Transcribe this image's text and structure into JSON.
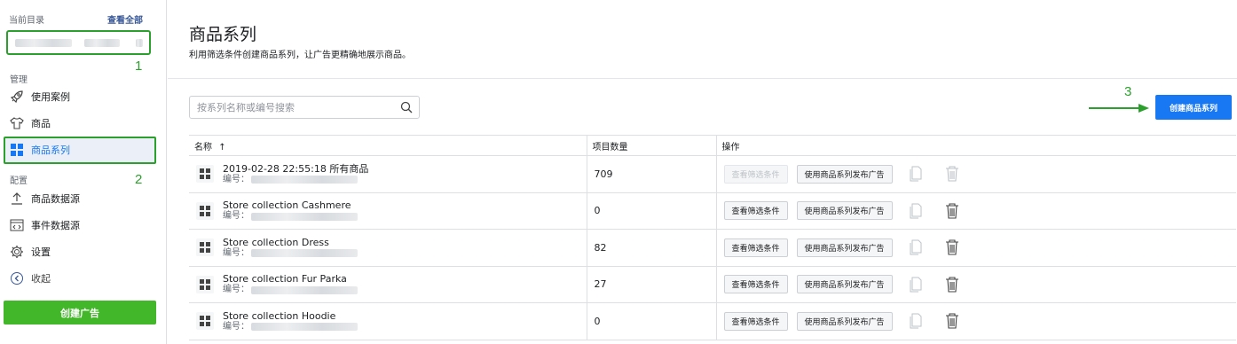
{
  "sidebar": {
    "current_catalog_label": "当前目录",
    "view_all": "查看全部",
    "section_manage": "管理",
    "section_config": "配置",
    "items": [
      {
        "label": "使用案例",
        "icon": "rocket-icon"
      },
      {
        "label": "商品",
        "icon": "shirt-icon"
      },
      {
        "label": "商品系列",
        "icon": "grid-icon",
        "active": true
      },
      {
        "label": "商品数据源",
        "icon": "upload-icon"
      },
      {
        "label": "事件数据源",
        "icon": "code-window-icon"
      },
      {
        "label": "设置",
        "icon": "gear-icon"
      },
      {
        "label": "收起",
        "icon": "collapse-icon"
      }
    ],
    "create_ad": "创建广告"
  },
  "annotations": {
    "a1": "1",
    "a2": "2",
    "a3": "3"
  },
  "main": {
    "title": "商品系列",
    "subtitle": "利用筛选条件创建商品系列，让广告更精确地展示商品。",
    "search_placeholder": "按系列名称或编号搜索",
    "create_set_button": "创建商品系列",
    "table": {
      "headers": {
        "name": "名称",
        "sort_indicator": "↑",
        "count": "项目数量",
        "actions": "操作"
      },
      "id_label": "编号：",
      "view_filters": "查看筛选条件",
      "publish_ad": "使用商品系列发布广告",
      "rows": [
        {
          "name": "2019-02-28 22:55:18 所有商品",
          "count": "709",
          "filters_disabled": true
        },
        {
          "name": "Store collection Cashmere",
          "count": "0",
          "filters_disabled": false
        },
        {
          "name": "Store collection Dress",
          "count": "82",
          "filters_disabled": false
        },
        {
          "name": "Store collection Fur Parka",
          "count": "27",
          "filters_disabled": false
        },
        {
          "name": "Store collection Hoodie",
          "count": "0",
          "filters_disabled": false
        }
      ]
    }
  },
  "colors": {
    "annotation": "#2ca02c",
    "primary": "#1877f2",
    "green_button": "#42b72a"
  }
}
